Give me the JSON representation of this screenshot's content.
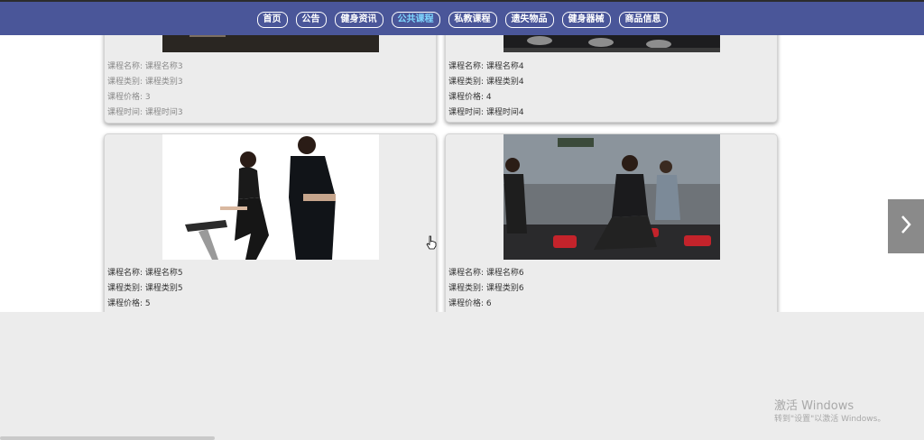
{
  "nav": {
    "items": [
      "首页",
      "公告",
      "健身资讯",
      "公共课程",
      "私教课程",
      "遗失物品",
      "健身器械",
      "商品信息"
    ],
    "active_index": 3
  },
  "labels": {
    "name": "课程名称:",
    "category": "课程类别:",
    "price": "课程价格:",
    "time": "课程时间:"
  },
  "cards": [
    {
      "name": "课程名称3",
      "category": "课程类别3",
      "price": "3",
      "time": "课程时间3"
    },
    {
      "name": "课程名称4",
      "category": "课程类别4",
      "price": "4",
      "time": "课程时间4"
    },
    {
      "name": "课程名称5",
      "category": "课程类别5",
      "price": "5"
    },
    {
      "name": "课程名称6",
      "category": "课程类别6",
      "price": "6"
    }
  ],
  "watermark": {
    "title": "激活 Windows",
    "subtitle": "转到\"设置\"以激活 Windows。"
  },
  "colors": {
    "nav_bg": "#4a5699",
    "nav_active": "#7fd7ff",
    "card_bg": "#ececec"
  },
  "icons": {
    "next": "chevron-right-icon",
    "cursor": "hand-pointer-icon"
  }
}
